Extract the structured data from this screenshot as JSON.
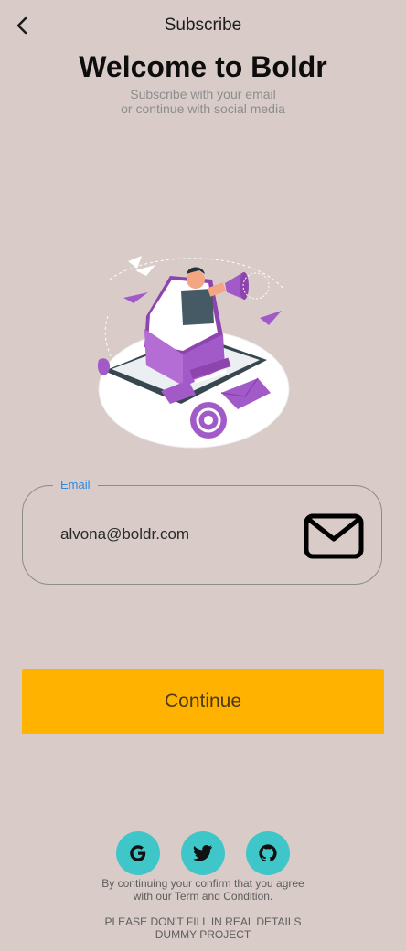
{
  "app_bar": {
    "title": "Subscribe",
    "back_icon": "chevron-left-icon"
  },
  "header": {
    "title": "Welcome to Boldr",
    "subtitle_line1": "Subscribe with your email",
    "subtitle_line2": "or continue with social media"
  },
  "email_field": {
    "label": "Email",
    "value": "alvona@boldr.com",
    "icon": "mail-icon"
  },
  "continue_button": {
    "label": "Continue"
  },
  "social": [
    {
      "name": "google",
      "icon": "google-icon"
    },
    {
      "name": "twitter",
      "icon": "twitter-icon"
    },
    {
      "name": "github",
      "icon": "github-icon"
    }
  ],
  "footer": {
    "terms_line1": "By continuing your confirm that you agree",
    "terms_line2": "with our Term and Condition.",
    "disclaimer_line1": "PLEASE DON'T FILL IN REAL DETAILS",
    "disclaimer_line2": "DUMMY PROJECT"
  },
  "colors": {
    "background": "#d8cbc8",
    "accent": "#ffb300",
    "social_bg": "#3ec6c8",
    "label_blue": "#2d89e5",
    "illustration_purple": "#a35ac9"
  }
}
